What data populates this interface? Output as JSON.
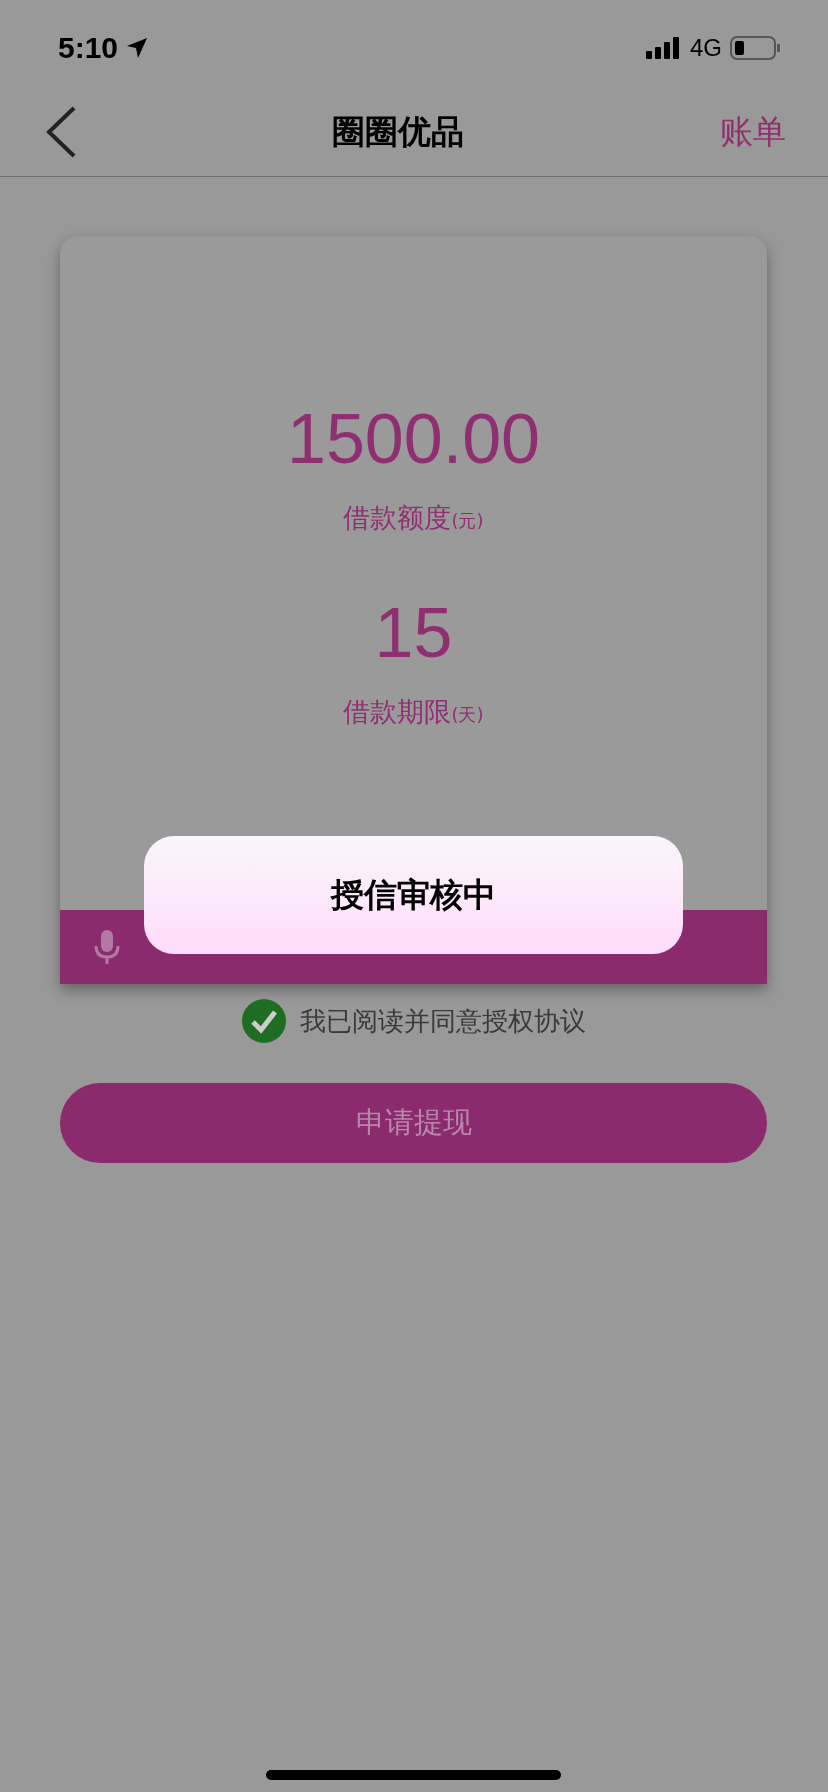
{
  "status_bar": {
    "time": "5:10",
    "network": "4G"
  },
  "nav": {
    "title": "圈圈优品",
    "action": "账单"
  },
  "loan": {
    "amount": "1500.00",
    "amount_label": "借款额度",
    "amount_unit": "(元)",
    "term": "15",
    "term_label": "借款期限",
    "term_unit": "(天)"
  },
  "agreement": {
    "checked": true,
    "text": "我已阅读并同意授权协议"
  },
  "submit_button": "申请提现",
  "toast": {
    "message": "授信审核中"
  }
}
